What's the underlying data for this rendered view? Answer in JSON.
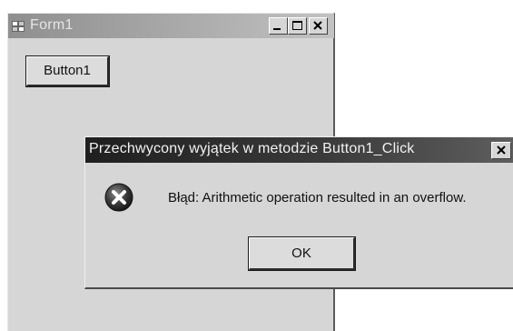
{
  "form": {
    "title": "Form1",
    "button1_label": "Button1"
  },
  "dialog": {
    "title": "Przechwycony wyjątek w metodzie Button1_Click",
    "message": "Błąd: Arithmetic operation resulted in an overflow.",
    "ok_label": "OK",
    "icon": "error-icon"
  },
  "icons": {
    "app": "app-icon",
    "minimize": "minimize-icon",
    "maximize": "maximize-icon",
    "close": "close-icon"
  },
  "colors": {
    "window_face": "#d6d6d6",
    "active_title_start": "#1f1f1f",
    "inactive_title_start": "#8f8f8f",
    "inactive_title_text": "#e6e6e6",
    "active_title_text": "#f2f2f2",
    "error_icon": "#3a3a3a"
  }
}
